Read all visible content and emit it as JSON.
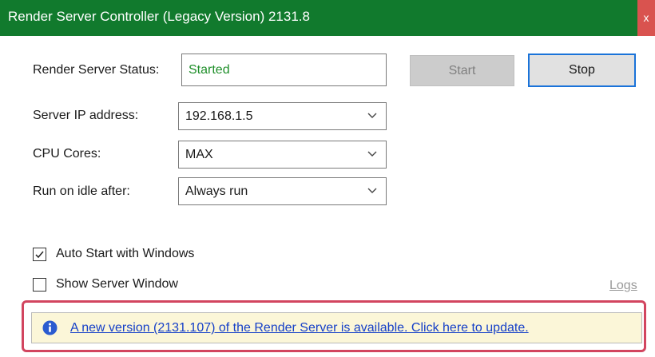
{
  "window": {
    "title": "Render Server Controller (Legacy Version) 2131.8",
    "close_glyph": "x"
  },
  "status": {
    "label": "Render Server Status:",
    "value": "Started"
  },
  "buttons": {
    "start_label": "Start",
    "stop_label": "Stop"
  },
  "fields": {
    "server_ip": {
      "label": "Server IP address:",
      "value": "192.168.1.5"
    },
    "cpu_cores": {
      "label": "CPU Cores:",
      "value": "MAX"
    },
    "run_on_idle": {
      "label": "Run on idle after:",
      "value": "Always run"
    }
  },
  "options": {
    "auto_start": {
      "label": "Auto Start with Windows",
      "checked": true
    },
    "show_window": {
      "label": "Show Server Window",
      "checked": false
    }
  },
  "logs_label": "Logs",
  "update": {
    "message": "A new version (2131.107) of the Render Server is available. Click here to update."
  },
  "colors": {
    "titlebar": "#117a2d",
    "status_text": "#1f8f2a",
    "stop_border": "#1a73d9",
    "update_highlight": "#d2455f",
    "update_background": "#fbf6d8",
    "link": "#1640c8",
    "info_icon": "#2a5bd0"
  },
  "icons": {
    "close": "close-icon",
    "dropdown": "chevron-down-icon",
    "check": "checkmark-icon",
    "info": "info-icon"
  }
}
